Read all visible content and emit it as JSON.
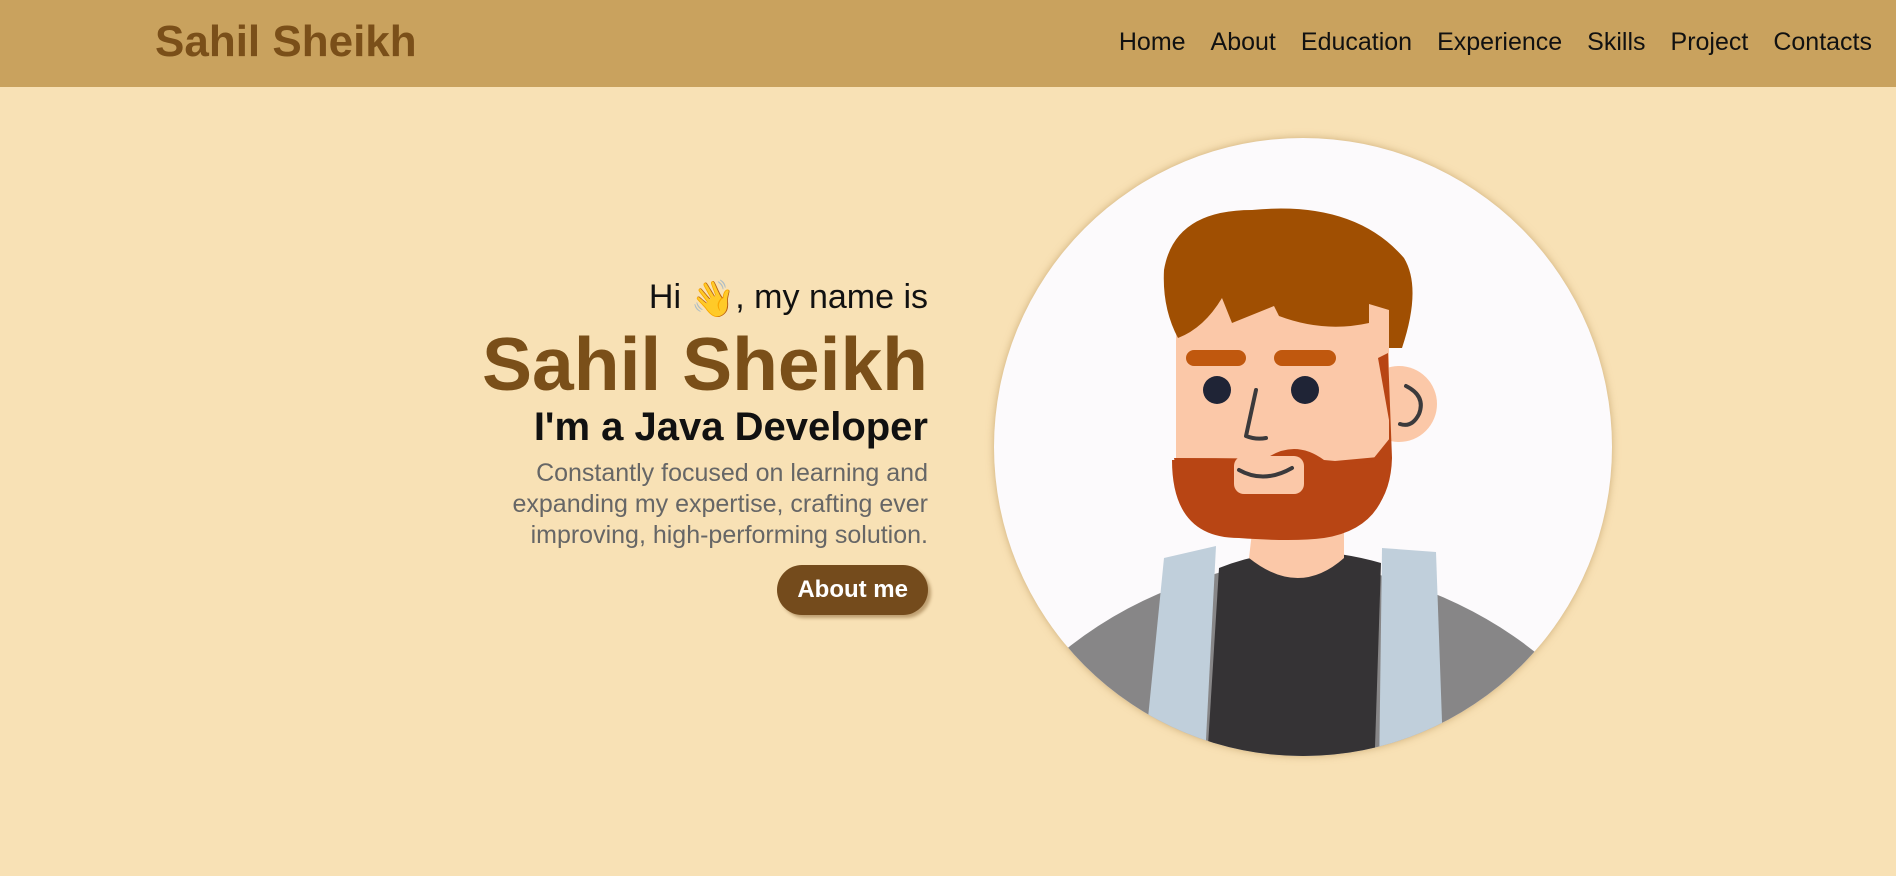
{
  "header": {
    "brand": "Sahil Sheikh",
    "nav": [
      {
        "label": "Home"
      },
      {
        "label": "About"
      },
      {
        "label": "Education"
      },
      {
        "label": "Experience"
      },
      {
        "label": "Skills"
      },
      {
        "label": "Project"
      },
      {
        "label": "Contacts"
      }
    ]
  },
  "hero": {
    "greeting_before": "Hi",
    "greeting_icon": "waving-hand",
    "greeting_after": ", my name is",
    "name": "Sahil Sheikh",
    "role": "I'm a Java Developer",
    "description": "Constantly focused on learning and expanding my expertise, crafting ever improving, high-performing solution.",
    "button_label": "About me"
  },
  "colors": {
    "background": "#f8e1b5",
    "navbar": "#c9a25e",
    "brand": "#7a4f19",
    "button": "#744b1c"
  },
  "avatar": {
    "icon": "developer-avatar-illustration"
  }
}
